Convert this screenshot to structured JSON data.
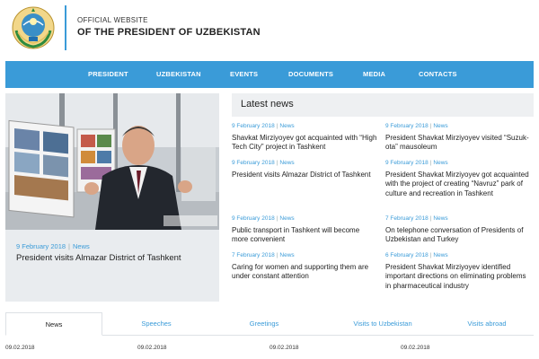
{
  "header": {
    "subtitle": "OFFICIAL WEBSITE",
    "title": "OF THE PRESIDENT OF UZBEKISTAN"
  },
  "nav": {
    "items": [
      "PRESIDENT",
      "UZBEKISTAN",
      "EVENTS",
      "DOCUMENTS",
      "MEDIA",
      "CONTACTS"
    ]
  },
  "featured": {
    "date": "9 February 2018",
    "category": "News",
    "title": "President visits Almazar District of Tashkent"
  },
  "latest": {
    "heading": "Latest news",
    "items": [
      {
        "date": "9 February 2018",
        "category": "News",
        "title": "Shavkat Mirziyoyev got acquainted with “High Tech City” project in Tashkent"
      },
      {
        "date": "9 February 2018",
        "category": "News",
        "title": "President Shavkat Mirziyoyev visited “Suzuk-ota” mausoleum"
      },
      {
        "date": "9 February 2018",
        "category": "News",
        "title": "President visits Almazar District of Tashkent"
      },
      {
        "date": "9 February 2018",
        "category": "News",
        "title": "President Shavkat Mirziyoyev got acquainted with the project of creating “Navruz” park of culture and recreation in Tashkent"
      },
      {
        "date": "9 February 2018",
        "category": "News",
        "title": "Public transport in Tashkent will become more convenient"
      },
      {
        "date": "7 February 2018",
        "category": "News",
        "title": "On telephone conversation of Presidents of Uzbekistan and Turkey"
      },
      {
        "date": "7 February 2018",
        "category": "News",
        "title": "Caring for women and supporting them are under constant attention"
      },
      {
        "date": "6 February 2018",
        "category": "News",
        "title": "President Shavkat Mirziyoyev identified important directions on eliminating problems in pharmaceutical industry"
      }
    ]
  },
  "tabs": [
    "News",
    "Speeches",
    "Greetings",
    "Visits to Uzbekistan",
    "Visits abroad"
  ],
  "dates": [
    "09.02.2018",
    "09.02.2018",
    "09.02.2018",
    "09.02.2018"
  ],
  "colors": {
    "accent": "#3a9bd8",
    "panel": "#e9ecef"
  }
}
